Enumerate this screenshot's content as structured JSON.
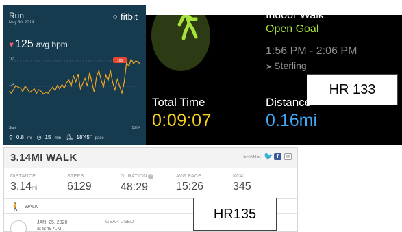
{
  "fitbit": {
    "activity": "Run",
    "date": "May 30, 2019",
    "logo": "fitbit",
    "avg_bpm_value": "125",
    "avg_bpm_unit": "avg bpm",
    "chart": {
      "y_ticks": [
        "163",
        "134"
      ],
      "marker_label": "165",
      "x_start": "Start",
      "x_end": "15:04",
      "series": [
        128,
        126,
        130,
        135,
        133,
        132,
        128,
        134,
        131,
        127,
        129,
        131,
        126,
        130,
        128,
        125,
        127,
        126,
        130,
        133,
        129,
        135,
        131,
        136,
        132,
        138,
        141,
        134,
        146,
        139,
        148,
        131,
        137,
        143,
        134,
        150,
        138,
        127,
        145,
        152,
        141,
        133,
        147,
        140,
        152,
        138,
        130,
        142,
        134,
        126,
        139,
        161,
        157,
        165,
        160,
        163,
        162,
        159
      ]
    },
    "footer": {
      "distance": "0.8",
      "distance_unit": "mi",
      "duration": "15",
      "duration_unit": "min",
      "pace": "18'45\"",
      "pace_unit": "pace"
    }
  },
  "watch": {
    "title": "Indoor Walk",
    "goal": "Open Goal",
    "time_range": "1:56 PM - 2:06 PM",
    "location": "Sterling",
    "total_time_label": "Total Time",
    "total_time_value": "0:09:07",
    "distance_label": "Distance",
    "distance_value": "0.16mi",
    "colors": {
      "goal": "#a7e23a",
      "time": "#f7d11a",
      "distance": "#3fa9f5"
    }
  },
  "hr_label_1": "HR 133",
  "hr_label_2": "HR135",
  "mapmywalk": {
    "title": "3.14MI WALK",
    "share_label": "SHARE:",
    "stats": [
      {
        "label": "DISTANCE",
        "value": "3.14",
        "unit": "mi"
      },
      {
        "label": "STEPS",
        "value": "6129",
        "unit": ""
      },
      {
        "label": "DURATION",
        "value": "48:29",
        "unit": ""
      },
      {
        "label": "AVG PACE",
        "value": "15:26",
        "unit": ""
      },
      {
        "label": "KCAL",
        "value": "345",
        "unit": ""
      }
    ],
    "activity_type": "WALK",
    "date_line1": "JAN. 25, 2020",
    "date_line2": "at 5:49 A.M.",
    "gear_label": "GEAR USED"
  }
}
